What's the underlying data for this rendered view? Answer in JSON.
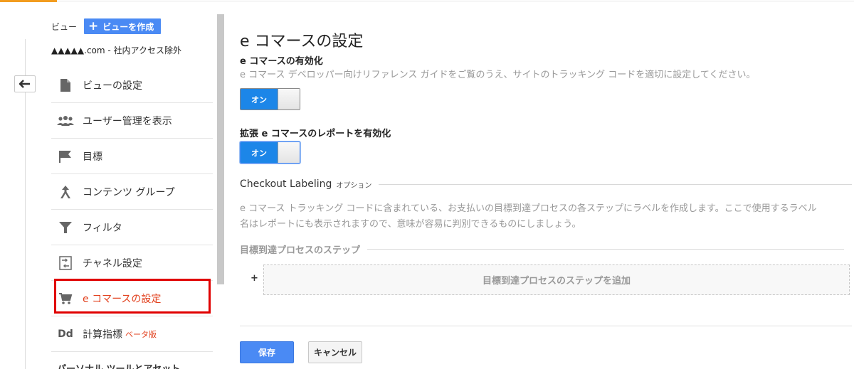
{
  "view_header": {
    "label": "ビュー",
    "create_button": "ビューを作成",
    "plus": "+",
    "view_name": "▲▲▲▲▲.com - 社内アクセス除外"
  },
  "nav": {
    "items": [
      {
        "label": "ビューの設定",
        "icon": "document-icon"
      },
      {
        "label": "ユーザー管理を表示",
        "icon": "people-icon"
      },
      {
        "label": "目標",
        "icon": "flag-icon"
      },
      {
        "label": "コンテンツ グループ",
        "icon": "merge-icon"
      },
      {
        "label": "フィルタ",
        "icon": "filter-icon"
      },
      {
        "label": "チャネル設定",
        "icon": "channel-icon"
      },
      {
        "label": "e コマースの設定",
        "icon": "cart-icon",
        "active": true
      },
      {
        "label": "計算指標",
        "icon": "dd-icon",
        "badge": "ベータ版",
        "icon_text": "Dd"
      }
    ],
    "section_title": "パーソナル ツールとアセット"
  },
  "main": {
    "title": "e コマースの設定",
    "ecommerce_enable": {
      "title": "e コマースの有効化",
      "description": "e コマース デベロッパー向けリファレンス ガイドをご覧のうえ、サイトのトラッキング コードを適切に設定してください。",
      "toggle_label": "オン"
    },
    "enhanced_enable": {
      "title": "拡張 e コマースのレポートを有効化",
      "toggle_label": "オン"
    },
    "checkout_labeling": {
      "title": "Checkout Labeling",
      "option": "オプション",
      "description_1": "e コマース トラッキング コードに含まれている、お支払いの目標到達プロセスの各ステップにラベルを作成します。ここで使用するラベル",
      "description_2": "名はレポートにも表示されますので、意味が容易に判別できるものにしましょう。"
    },
    "funnel_steps": {
      "title": "目標到達プロセスのステップ",
      "plus": "+",
      "add_label": "目標到達プロセスのステップを追加"
    },
    "buttons": {
      "save": "保存",
      "cancel": "キャンセル"
    }
  },
  "colors": {
    "accent_blue": "#4a8af4",
    "toggle_blue": "#1c86e8",
    "active_red": "#e2401d",
    "highlight_red": "#e00000",
    "top_accent": "#f29c1f"
  }
}
